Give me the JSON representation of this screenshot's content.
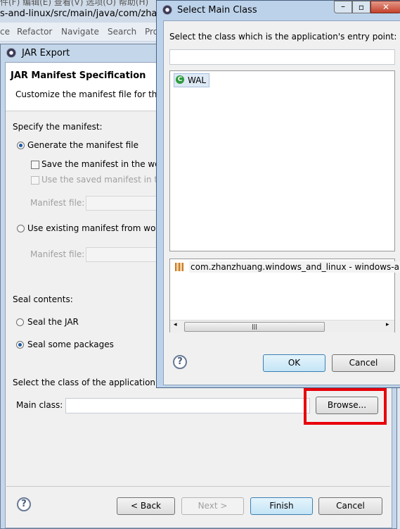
{
  "background": {
    "menu_cjk": "件(F)   编辑(E)   查看(V)   选项(O)   帮助(H)",
    "path": "s-and-linux/src/main/java/com/zhanzh",
    "menu": [
      "ce",
      "Refactor",
      "Navigate",
      "Search",
      "Pro"
    ]
  },
  "jar_export": {
    "title": "JAR Export",
    "header_title": "JAR Manifest Specification",
    "header_desc": "Customize the manifest file for the",
    "specify_label": "Specify the manifest:",
    "generate_radio": "Generate the manifest file",
    "save_checkbox": "Save the manifest in the wor",
    "use_saved_checkbox": "Use the saved manifest in th",
    "manifest_file_label": "Manifest file:",
    "use_existing_radio": "Use existing manifest from worl",
    "manifest_file_label2": "Manifest file:",
    "seal_label": "Seal contents:",
    "seal_jar_radio": "Seal the JAR",
    "seal_some_radio": "Seal some packages",
    "select_class_label": "Select the class of the application e",
    "main_class_label": "Main class:",
    "main_class_value": "",
    "browse": "Browse...",
    "back": "< Back",
    "next": "Next >",
    "finish": "Finish",
    "cancel": "Cancel"
  },
  "select_main_class": {
    "title": "Select Main Class",
    "prompt": "Select the class which is the application's entry point:",
    "filter_value": "",
    "classes": [
      "WAL"
    ],
    "packages": [
      "com.zhanzhuang.windows_and_linux - windows-and"
    ],
    "ok": "OK",
    "cancel": "Cancel"
  },
  "highlight_color": "#e8000b"
}
